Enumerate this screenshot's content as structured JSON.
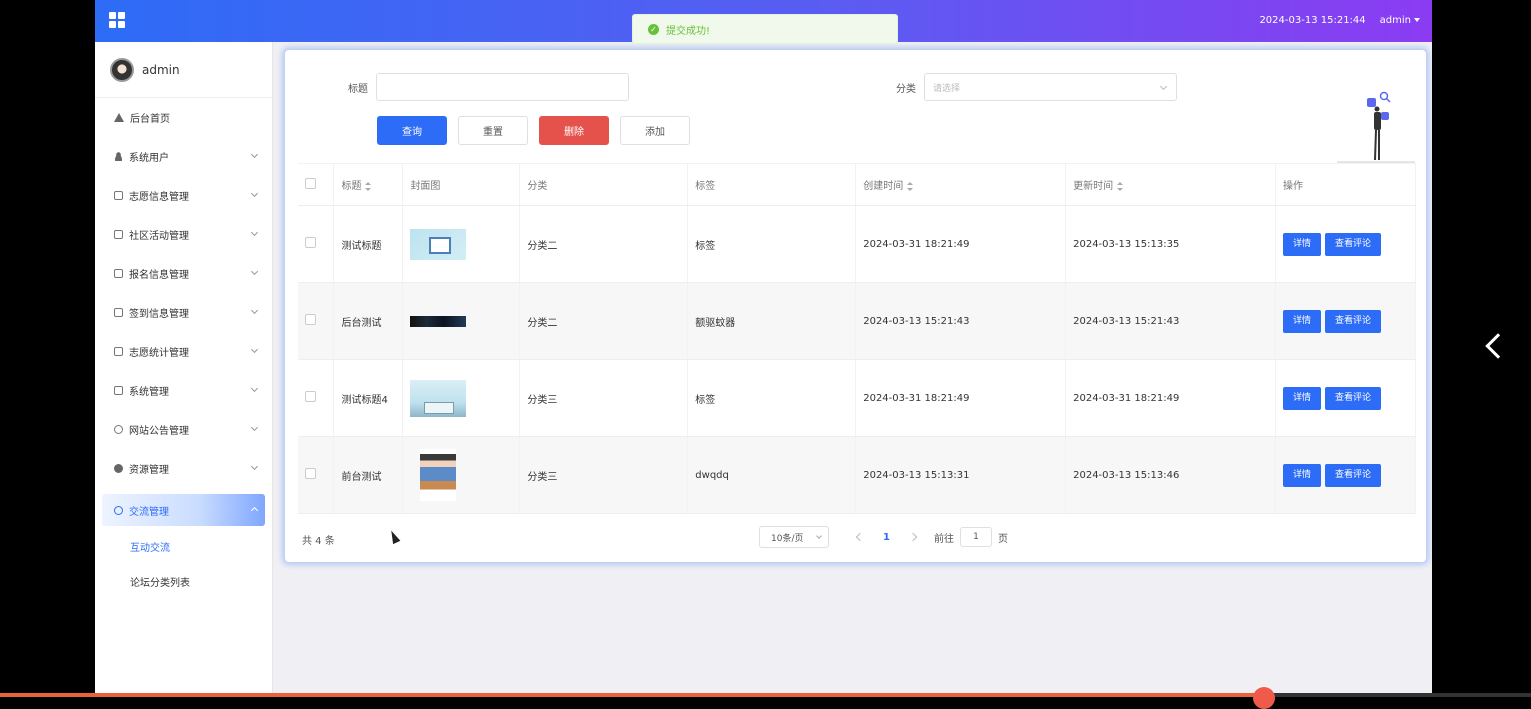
{
  "topbar": {
    "datetime": "2024-03-13 15:21:44",
    "user": "admin"
  },
  "toast": {
    "message": "提交成功!"
  },
  "sidebar": {
    "username": "admin",
    "items": [
      {
        "label": "后台首页",
        "icon": "home-icon"
      },
      {
        "label": "系统用户",
        "icon": "person-icon"
      },
      {
        "label": "志愿信息管理",
        "icon": "doc-icon"
      },
      {
        "label": "社区活动管理",
        "icon": "doc-icon"
      },
      {
        "label": "报名信息管理",
        "icon": "doc-icon"
      },
      {
        "label": "签到信息管理",
        "icon": "doc-icon"
      },
      {
        "label": "志愿统计管理",
        "icon": "doc-icon"
      },
      {
        "label": "系统管理",
        "icon": "image-icon"
      },
      {
        "label": "网站公告管理",
        "icon": "info-icon"
      },
      {
        "label": "资源管理",
        "icon": "bulb-icon"
      },
      {
        "label": "交流管理",
        "icon": "chat-icon"
      }
    ],
    "submenu": [
      {
        "label": "互动交流"
      },
      {
        "label": "论坛分类列表"
      }
    ]
  },
  "search": {
    "title_label": "标题",
    "title_value": "",
    "category_label": "分类",
    "category_placeholder": "请选择"
  },
  "actions": {
    "query": "查询",
    "reset": "重置",
    "delete": "删除",
    "add": "添加"
  },
  "table": {
    "headers": {
      "title": "标题",
      "cover": "封面图",
      "category": "分类",
      "tags": "标签",
      "created": "创建时间",
      "updated": "更新时间",
      "ops": "操作"
    },
    "rows": [
      {
        "title": "测试标题",
        "category": "分类二",
        "tags": "标签",
        "created": "2024-03-31 18:21:49",
        "updated": "2024-03-13 15:13:35"
      },
      {
        "title": "后台测试",
        "category": "分类二",
        "tags": "额驱蚊器",
        "created": "2024-03-13 15:21:43",
        "updated": "2024-03-13 15:21:43"
      },
      {
        "title": "测试标题4",
        "category": "分类三",
        "tags": "标签",
        "created": "2024-03-31 18:21:49",
        "updated": "2024-03-31 18:21:49"
      },
      {
        "title": "前台测试",
        "category": "分类三",
        "tags": "dwqdq",
        "created": "2024-03-13 15:13:31",
        "updated": "2024-03-13 15:13:46"
      }
    ],
    "detail_label": "详情",
    "comments_label": "查看评论"
  },
  "pagination": {
    "total": "共 4 条",
    "page_size": "10条/页",
    "current_page": "1",
    "goto_prefix": "前往",
    "goto_value": "1",
    "goto_suffix": "页"
  }
}
